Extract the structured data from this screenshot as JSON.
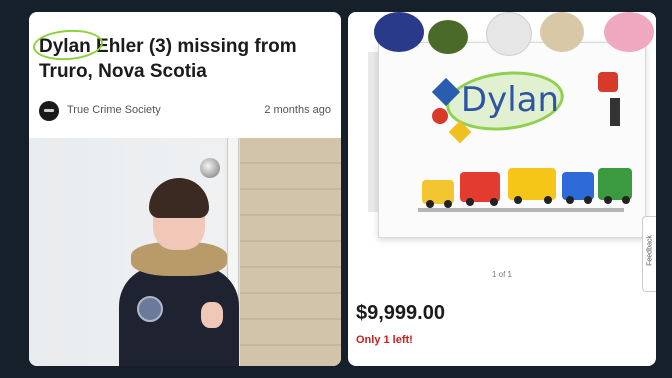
{
  "article": {
    "headline": "Dylan Ehler (3) missing from Truro, Nova Scotia",
    "source": "True Crime Society",
    "time_ago": "2 months ago"
  },
  "product": {
    "name_on_box": "Dylan",
    "pager": "1 of 1",
    "price": "$9,999.00",
    "stock": "Only 1 left!",
    "feedback_label": "Feedback"
  },
  "colors": {
    "background": "#15202b",
    "highlight_circle": "#8ed13a",
    "name_text": "#2d54a5",
    "stock_alert": "#c8201f"
  }
}
